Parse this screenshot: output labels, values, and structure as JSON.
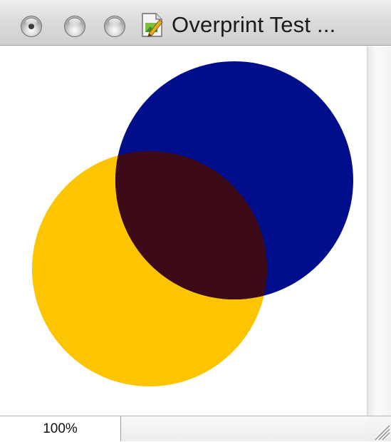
{
  "window": {
    "title": "Overprint Test ...",
    "controls": [
      {
        "name": "close-button"
      },
      {
        "name": "minimize-button"
      },
      {
        "name": "zoom-button"
      }
    ],
    "proxy_icon": "document-icon"
  },
  "canvas": {
    "background": "#ffffff",
    "circles": [
      {
        "name": "yellow-circle",
        "color": "#fcc500"
      },
      {
        "name": "blue-circle",
        "color": "#000e8c"
      },
      {
        "name": "overlap-region",
        "color": "#3d0b18"
      }
    ]
  },
  "statusbar": {
    "zoom": "100%"
  },
  "icons": {
    "resize": "resize-grip-icon"
  }
}
